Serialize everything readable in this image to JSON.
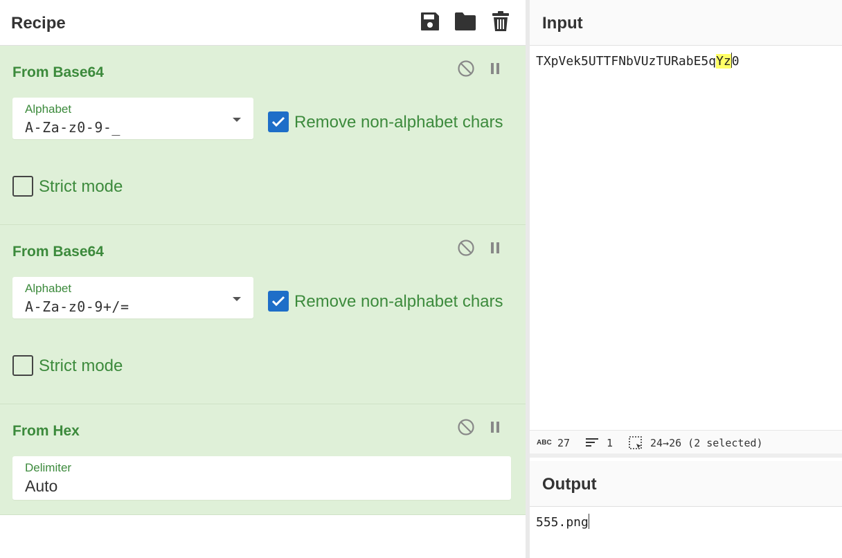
{
  "recipe": {
    "title": "Recipe",
    "header_icons": [
      "save-icon",
      "folder-icon",
      "trash-icon"
    ],
    "operations": [
      {
        "title": "From Base64",
        "field_label": "Alphabet",
        "field_value": "A-Za-z0-9-_",
        "remove_label": "Remove non-alphabet chars",
        "remove_checked": true,
        "strict_label": "Strict mode",
        "strict_checked": false
      },
      {
        "title": "From Base64",
        "field_label": "Alphabet",
        "field_value": "A-Za-z0-9+/=",
        "remove_label": "Remove non-alphabet chars",
        "remove_checked": true,
        "strict_label": "Strict mode",
        "strict_checked": false
      },
      {
        "title": "From Hex",
        "field_label": "Delimiter",
        "field_value": "Auto"
      }
    ]
  },
  "input": {
    "title": "Input",
    "text_before": "TXpVek5UTTFNbVUzTURabE5q",
    "text_selected": "Yz",
    "text_after": "0",
    "status": {
      "length": "27",
      "lines": "1",
      "selection": "24→26 (2 selected)"
    }
  },
  "output": {
    "title": "Output",
    "text": "555.png"
  },
  "colors": {
    "op_background": "#dff0d8",
    "op_title": "#3c8a3c",
    "checkbox": "#1e6ec8",
    "highlight": "#ffff66"
  }
}
